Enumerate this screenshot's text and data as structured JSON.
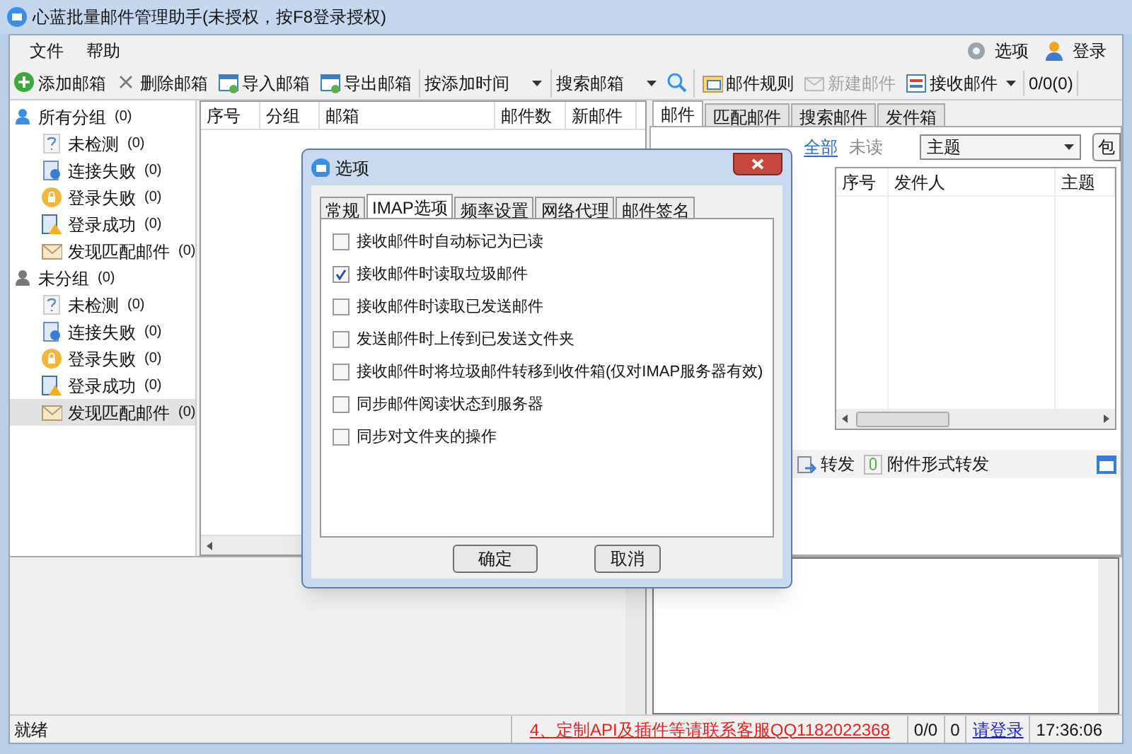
{
  "window": {
    "title": "心蓝批量邮件管理助手(未授权，按F8登录授权)"
  },
  "menu": [
    "文件",
    "帮助"
  ],
  "header_actions": [
    {
      "label": "选项"
    },
    {
      "label": "登录"
    }
  ],
  "toolbar": [
    {
      "kind": "button",
      "label": "添加邮箱",
      "disabled": false,
      "dropdown": false
    },
    {
      "kind": "button",
      "label": "删除邮箱",
      "disabled": false,
      "dropdown": false
    },
    {
      "kind": "button",
      "label": "导入邮箱",
      "disabled": false,
      "dropdown": false
    },
    {
      "kind": "button",
      "label": "导出邮箱",
      "disabled": false,
      "dropdown": false
    },
    {
      "kind": "select",
      "value": "按添加时间"
    },
    {
      "kind": "select",
      "value": "搜索邮箱"
    },
    {
      "kind": "search"
    },
    {
      "kind": "button",
      "label": "邮件规则",
      "disabled": false,
      "dropdown": false
    },
    {
      "kind": "button",
      "label": "新建邮件",
      "disabled": true,
      "dropdown": false
    },
    {
      "kind": "button",
      "label": "接收邮件",
      "disabled": false,
      "dropdown": true
    },
    {
      "kind": "counter",
      "label": "0/0(0)"
    }
  ],
  "groups": [
    {
      "label": "所有分组",
      "count": "(0)",
      "selected": false,
      "children": [
        {
          "label": "未检测",
          "count": "(0)",
          "selected": false
        },
        {
          "label": "连接失败",
          "count": "(0)",
          "selected": false
        },
        {
          "label": "登录失败",
          "count": "(0)",
          "selected": false
        },
        {
          "label": "登录成功",
          "count": "(0)",
          "selected": false
        },
        {
          "label": "发现匹配邮件",
          "count": "(0)",
          "selected": false
        }
      ]
    },
    {
      "label": "未分组",
      "count": "(0)",
      "selected": false,
      "children": [
        {
          "label": "未检测",
          "count": "(0)",
          "selected": false
        },
        {
          "label": "连接失败",
          "count": "(0)",
          "selected": false
        },
        {
          "label": "登录失败",
          "count": "(0)",
          "selected": false
        },
        {
          "label": "登录成功",
          "count": "(0)",
          "selected": false
        },
        {
          "label": "发现匹配邮件",
          "count": "(0)",
          "selected": true
        }
      ]
    }
  ],
  "mailbox_table": {
    "columns": [
      "序号",
      "分组",
      "邮箱",
      "邮件数",
      "新邮件"
    ]
  },
  "mail_panel": {
    "tabs": [
      {
        "label": "邮件",
        "selected": true
      },
      {
        "label": "匹配邮件",
        "selected": false
      },
      {
        "label": "搜索邮件",
        "selected": false
      },
      {
        "label": "发件箱",
        "selected": false
      }
    ],
    "filters": [
      {
        "label": "全部",
        "selected": true
      },
      {
        "label": "未读",
        "selected": false
      }
    ],
    "field_select": "主题",
    "search_button": "包",
    "columns": [
      "序号",
      "发件人",
      "主题"
    ],
    "actions": [
      "转发",
      "附件形式转发"
    ]
  },
  "status_bar": {
    "message": "就绪",
    "notice": "4、定制API及插件等请联系客服QQ1182022368",
    "counts": [
      "0/0",
      "0"
    ],
    "login_link": "请登录",
    "time": "17:36:06"
  },
  "dialog": {
    "title": "选项",
    "tabs": [
      {
        "label": "常规",
        "selected": false
      },
      {
        "label": "IMAP选项",
        "selected": true
      },
      {
        "label": "频率设置",
        "selected": false
      },
      {
        "label": "网络代理",
        "selected": false
      },
      {
        "label": "邮件签名",
        "selected": false
      }
    ],
    "options": [
      {
        "label": "接收邮件时自动标记为已读",
        "checked": false
      },
      {
        "label": "接收邮件时读取垃圾邮件",
        "checked": true
      },
      {
        "label": "接收邮件时读取已发送邮件",
        "checked": false
      },
      {
        "label": "发送邮件时上传到已发送文件夹",
        "checked": false
      },
      {
        "label": "接收邮件时将垃圾邮件转移到收件箱(仅对IMAP服务器有效)",
        "checked": false
      },
      {
        "label": "同步邮件阅读状态到服务器",
        "checked": false
      },
      {
        "label": "同步对文件夹的操作",
        "checked": false
      }
    ],
    "buttons": [
      "确定",
      "取消"
    ]
  }
}
